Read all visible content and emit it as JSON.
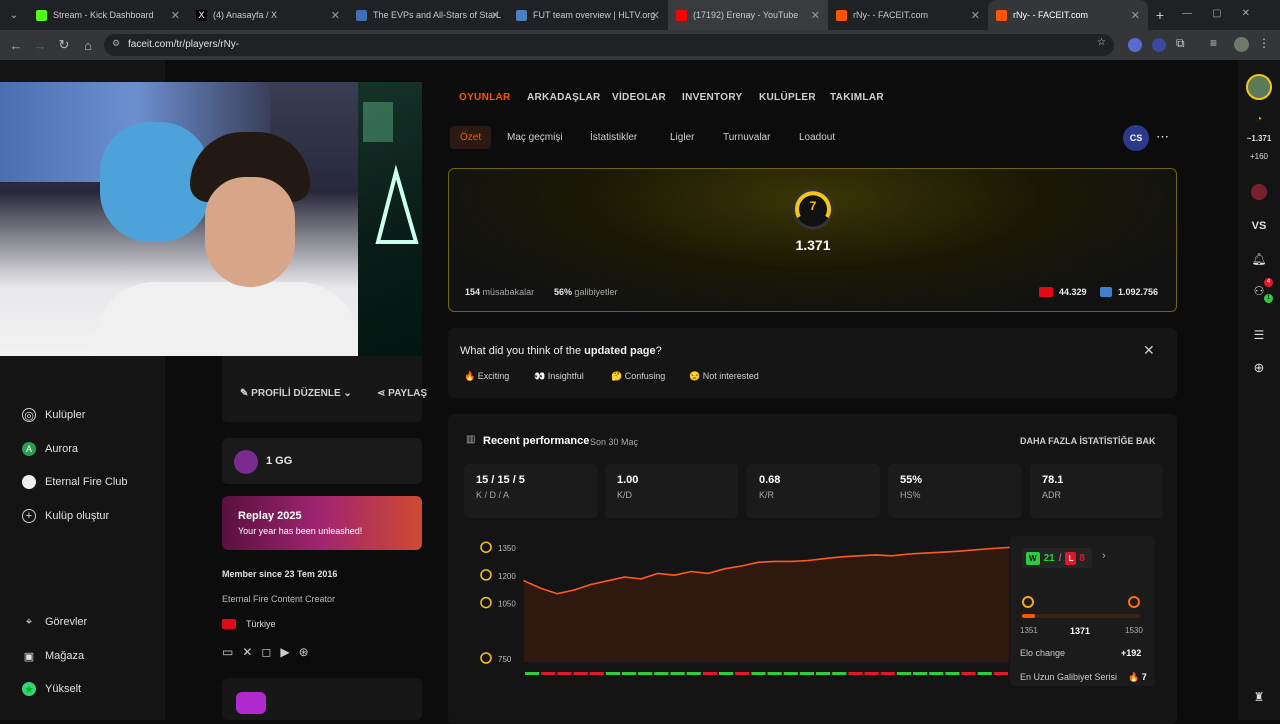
{
  "browser": {
    "tabs": [
      {
        "title": "Stream - Kick Dashboard",
        "color": "#53fc18"
      },
      {
        "title": "(4) Anasayfa / X",
        "color": "#ffffff"
      },
      {
        "title": "The EVPs and All-Stars of StarL",
        "color": "#3f6fb5"
      },
      {
        "title": "FUT team overview | HLTV.org",
        "color": "#4a7fc0"
      },
      {
        "title": "(17192) Erenay - YouTube",
        "color": "#ff0000"
      },
      {
        "title": "rNy- - FACEIT.com",
        "color": "#ff5500"
      },
      {
        "title": "rNy- - FACEIT.com",
        "color": "#ff5500"
      }
    ],
    "url": "faceit.com/tr/players/rNy-"
  },
  "left_nav": {
    "items": [
      {
        "label": "Kulüpler"
      },
      {
        "label": "Aurora"
      },
      {
        "label": "Eternal Fire Club"
      },
      {
        "label": "Kulüp oluştur"
      },
      {
        "label": "Görevler"
      },
      {
        "label": "Mağaza"
      },
      {
        "label": "Yükselt"
      }
    ]
  },
  "profile": {
    "edit_label": "PROFİLİ DÜZENLE",
    "share_label": "PAYLAŞ",
    "gg_label": "1 GG",
    "replay_title": "Replay 2025",
    "replay_sub": "Your year has been unleashed!",
    "member_since": "Member since 23 Tem 2016",
    "bio": "Eternal Fire Content Creator",
    "country": "Türkiye"
  },
  "top_tabs": [
    "OYUNLAR",
    "ARKADAŞLAR",
    "VİDEOLAR",
    "INVENTORY",
    "KULÜPLER",
    "TAKIMLAR"
  ],
  "sub_tabs": [
    "Özet",
    "Maç geçmişi",
    "İstatistikler",
    "Ligler",
    "Turnuvalar",
    "Loadout"
  ],
  "game_badge": "CS",
  "elo": {
    "level": "7",
    "value": "1.371",
    "matches_num": "154",
    "matches_label": "müsabakalar",
    "win_num": "56%",
    "win_label": "galibiyetler",
    "country_rank": "44.329",
    "region_rank": "1.092.756"
  },
  "feedback": {
    "question_prefix": "What did you think of the ",
    "question_bold": "updated page",
    "question_suffix": "?",
    "options": [
      "🔥 Exciting",
      "👀 Insightful",
      "🤔 Confusing",
      "😒 Not interested"
    ]
  },
  "performance": {
    "title": "Recent performance",
    "subtitle": "Son 30 Maç",
    "more_link": "DAHA FAZLA İSTATİSTİĞE BAK",
    "stats": [
      {
        "value": "15 / 15 / 5",
        "label": "K / D / A"
      },
      {
        "value": "1.00",
        "label": "K/D"
      },
      {
        "value": "0.68",
        "label": "K/R"
      },
      {
        "value": "55%",
        "label": "HS%"
      },
      {
        "value": "78.1",
        "label": "ADR"
      }
    ],
    "chart_data": {
      "type": "area",
      "title": "",
      "y_ticks": [
        "1350",
        "1200",
        "1050",
        "750"
      ],
      "ylim": [
        750,
        1400
      ],
      "values": [
        1190,
        1150,
        1120,
        1140,
        1170,
        1190,
        1210,
        1200,
        1230,
        1220,
        1240,
        1230,
        1255,
        1270,
        1290,
        1295,
        1295,
        1300,
        1310,
        1320,
        1325,
        1330,
        1325,
        1335,
        1340,
        1345,
        1350,
        1358,
        1365,
        1371
      ],
      "results": [
        "W",
        "L",
        "L",
        "L",
        "L",
        "W",
        "W",
        "W",
        "W",
        "W",
        "W",
        "L",
        "W",
        "L",
        "W",
        "W",
        "W",
        "W",
        "W",
        "W",
        "L",
        "L",
        "L",
        "W",
        "W",
        "W",
        "W",
        "L",
        "W",
        "L"
      ]
    },
    "wins": "21",
    "losses": "8",
    "range_low": "1351",
    "range_current": "1371",
    "range_high": "1530",
    "elo_change_label": "Elo change",
    "elo_change_value": "+192",
    "streak_label": "En Uzun Galibiyet Serisi",
    "streak_value": "🔥 7"
  },
  "right_sidebar": {
    "elo": "~1.371",
    "gain": "+160",
    "vs": "VS",
    "friends_badge": "4",
    "friends_online": "1"
  }
}
